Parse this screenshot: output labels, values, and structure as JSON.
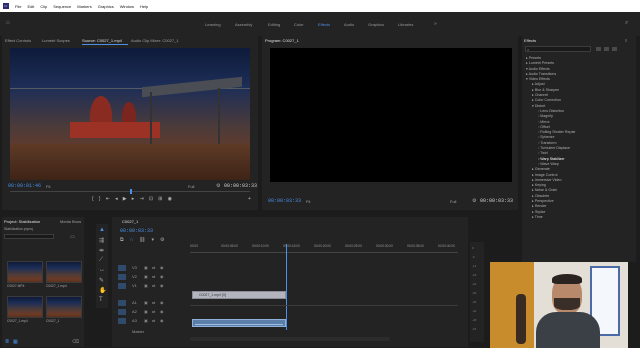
{
  "menu": [
    "File",
    "Edit",
    "Clip",
    "Sequence",
    "Markers",
    "Graphics",
    "Window",
    "Help"
  ],
  "workspaces": [
    "Learning",
    "Assembly",
    "Editing",
    "Color",
    "Effects",
    "Audio",
    "Graphics",
    "Libraries"
  ],
  "active_workspace": "Effects",
  "source_panel": {
    "tabs": [
      "Effect Controls",
      "Lumetri Scopes",
      "Source: C0027_1.mp4",
      "Audio Clip Mixer: C0027_1"
    ],
    "timecode": "00:00:01:46",
    "fit": "Fit",
    "resolution": "Full",
    "duration": "00:00:03:33"
  },
  "program_panel": {
    "title": "Program: C0027_1",
    "timecode": "00:00:03:33",
    "fit": "Fit",
    "resolution": "Full",
    "duration": "00:00:03:33"
  },
  "effects_panel": {
    "title": "Effects",
    "tree": [
      "Presets",
      "Lumetri Presets",
      "Audio Effects",
      "Audio Transitions",
      "Video Effects",
      "Adjust",
      "Blur & Sharpen",
      "Channel",
      "Color Correction",
      "Distort",
      "Lens Distortion",
      "Magnify",
      "Mirror",
      "Offset",
      "Rolling Shutter Repair",
      "Spherize",
      "Transform",
      "Turbulent Displace",
      "Twirl",
      "Warp Stabilizer",
      "Wave Warp",
      "Generate",
      "Image Control",
      "Immersive Video",
      "Keying",
      "Noise & Grain",
      "Obsolete",
      "Perspective",
      "Render",
      "Stylize",
      "Time"
    ]
  },
  "project_panel": {
    "tabs": [
      "Project: Stabilization",
      "Media Brow"
    ],
    "project_file": "Stabilization.prproj",
    "items": [
      {
        "name": "C0027.MP4"
      },
      {
        "name": "C0027_1.mp4"
      },
      {
        "name": "C0027_1.mp4"
      },
      {
        "name": "C0027_1"
      }
    ]
  },
  "timeline": {
    "sequence_tab": "C0027_1",
    "timecode": "00:00:03:33",
    "ruler": [
      "00:00",
      "00:00:05:00",
      "00:00:10:00",
      "00:00:15:00",
      "00:00:20:00",
      "00:00:25:00",
      "00:00:30:00",
      "00:00:35:00",
      "00:00:40:00"
    ],
    "video_tracks": [
      "V3",
      "V2",
      "V1"
    ],
    "audio_tracks": [
      "A1",
      "A2",
      "A3"
    ],
    "master_label": "Master",
    "clip_label": "C0027_1.mp4 [V]",
    "audio_meter": [
      "0",
      "-6",
      "-12",
      "-18",
      "-24",
      "-30",
      "-36",
      "-42",
      "-48",
      "-54"
    ]
  },
  "colors": {
    "accent": "#4a8fe8",
    "panel": "#232323",
    "background": "#1c1c1c",
    "clip_video": "#a8a8b4",
    "clip_audio": "#5b7fa8"
  }
}
